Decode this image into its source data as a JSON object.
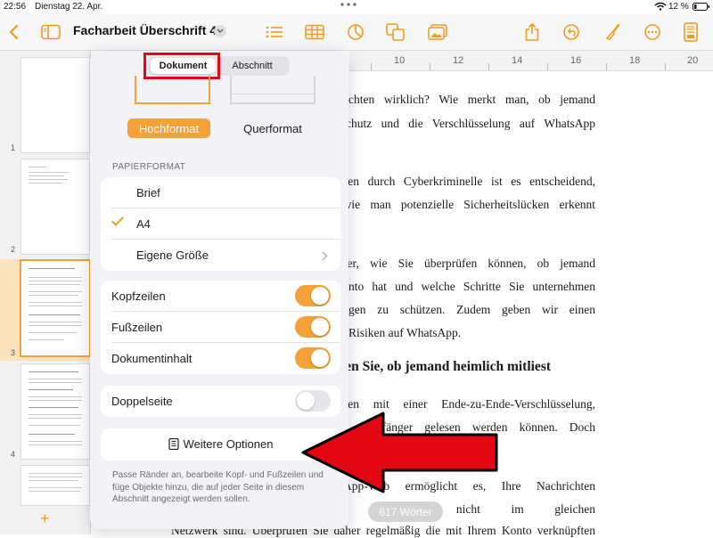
{
  "status": {
    "time": "22:56",
    "date": "Dienstag 22. Apr.",
    "battery": "12 %"
  },
  "toolbar": {
    "title": "Facharbeit Überschrift 4",
    "icons": [
      "back-chevron-icon",
      "sidebar-icon",
      "title-chevron-icon",
      "list-icon",
      "table-icon",
      "chart-icon",
      "shapes-icon",
      "media-icon",
      "share-icon",
      "undo-icon",
      "paintbrush-icon",
      "more-icon",
      "document-setup-icon"
    ]
  },
  "colors": {
    "accent": "#f4a13a",
    "annotation_red": "#e30613"
  },
  "ruler": {
    "ticks": [
      "10",
      "12",
      "14",
      "16",
      "18",
      "20"
    ]
  },
  "sidebar": {
    "pages": [
      "1",
      "2",
      "3",
      "4"
    ],
    "selected_page": "3"
  },
  "document": {
    "lines": [
      "chrichten wirklich? Wie merkt man, ob jemand",
      "enschutz und die Verschlüsselung auf WhatsApp",
      "ungen durch Cyberkriminelle ist es entscheidend,",
      ", wie man potenzielle Sicherheitslücken erkennt",
      "daher, wie Sie überprüfen können, ob jemand",
      "-Konto hat und welche Schritte Sie unternehmen",
      "ltungen zu schützen. Zudem geben wir einen",
      "ntz-Risiken auf WhatsApp.",
      "nnen Sie, ob jemand heimlich mitliest",
      "ichten mit einer Ende-zu-Ende-Verschlüsselung,",
      "und Empfänger gelesen werden können. Doch",
      "iken.",
      "atsApp-Web ermöglicht es, Ihre Nachrichten",
      "rtpl  Computer nicht im gleichen",
      "Netzwerk sind. Überprüfen Sie daher regelmäßig die mit Ihrem Konto verknüpften"
    ],
    "word_count": "617 Wörter"
  },
  "popover": {
    "tabs": [
      "Dokument",
      "Abschnitt"
    ],
    "selected_tab": "Dokument",
    "orientation": {
      "portrait": "Hochformat",
      "landscape": "Querformat",
      "selected": "Hochformat"
    },
    "paper_format_label": "PAPIERFORMAT",
    "paper_options": [
      "Brief",
      "A4",
      "Eigene Größe"
    ],
    "selected_paper": "A4",
    "toggles": [
      {
        "label": "Kopfzeilen",
        "on": true
      },
      {
        "label": "Fußzeilen",
        "on": true
      },
      {
        "label": "Dokumentinhalt",
        "on": true
      }
    ],
    "facing_pages": {
      "label": "Doppelseite",
      "on": false
    },
    "more_options": "Weitere Optionen",
    "footnote": "Passe Ränder an, bearbeite Kopf- und Fußzeilen und füge Objekte hinzu, die auf jeder Seite in diesem Abschnitt angezeigt werden sollen."
  }
}
